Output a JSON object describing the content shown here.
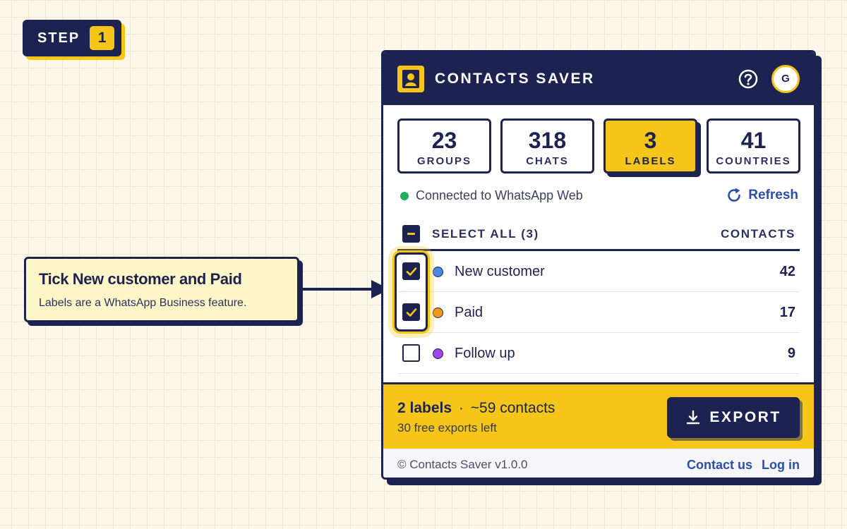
{
  "step": {
    "label": "STEP",
    "number": "1"
  },
  "callout": {
    "title": "Tick New customer and Paid",
    "subtitle": "Labels are a WhatsApp Business feature."
  },
  "app": {
    "title": "CONTACTS SAVER",
    "help_icon": "help-circle-icon",
    "avatar_initial": "G"
  },
  "stats": [
    {
      "value": "23",
      "label": "GROUPS",
      "active": false
    },
    {
      "value": "318",
      "label": "CHATS",
      "active": false
    },
    {
      "value": "3",
      "label": "LABELS",
      "active": true
    },
    {
      "value": "41",
      "label": "COUNTRIES",
      "active": false
    }
  ],
  "connection": {
    "status": "Connected to WhatsApp Web",
    "status_color": "#1fb15a",
    "refresh_label": "Refresh"
  },
  "list": {
    "select_all": "SELECT ALL (3)",
    "contacts_header": "CONTACTS",
    "items": [
      {
        "name": "New customer",
        "count": "42",
        "checked": true,
        "color": "#4a86e8"
      },
      {
        "name": "Paid",
        "count": "17",
        "checked": true,
        "color": "#f29a1d"
      },
      {
        "name": "Follow up",
        "count": "9",
        "checked": false,
        "color": "#a145e8"
      }
    ]
  },
  "selection": {
    "labels_text": "2 labels",
    "separator": "·",
    "contacts_text": "~59 contacts",
    "free_exports": "30 free exports left",
    "export_label": "EXPORT",
    "export_icon": "download-icon"
  },
  "footer": {
    "copyright": "© Contacts Saver v1.0.0",
    "contact_us": "Contact us",
    "login": "Log in"
  },
  "colors": {
    "navy": "#1c2350",
    "accent_yellow": "#f5c518",
    "link_blue": "#2b4fa8",
    "background": "#fbf8ea"
  }
}
